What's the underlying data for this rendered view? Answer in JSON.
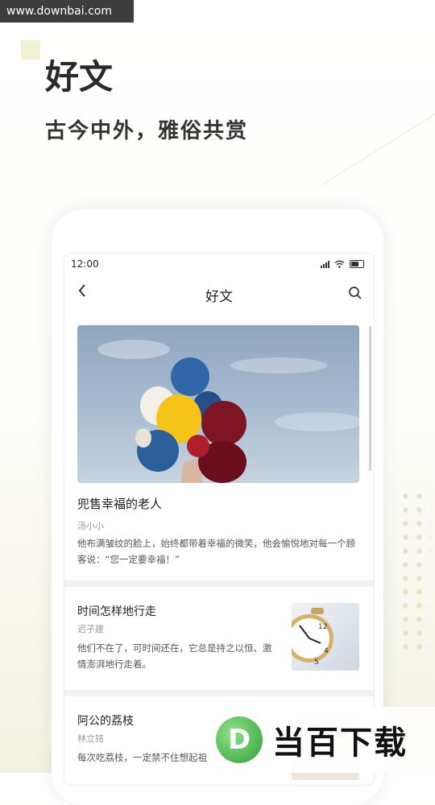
{
  "watermark_top": "www.downbai.com",
  "hero": {
    "title": "好文",
    "subtitle": "古今中外，雅俗共赏"
  },
  "statusbar": {
    "time": "12:00"
  },
  "nav": {
    "back_icon": "chevron-left-icon",
    "title": "好文",
    "search_icon": "search-icon"
  },
  "articles": [
    {
      "title": "兜售幸福的老人",
      "author": "汤小小",
      "excerpt": "他布满皱纹的脸上，始终都带着幸福的微笑，他会愉悦地对每一个顾客说：“您一定要幸福！”",
      "image": "balloons-photo"
    },
    {
      "title": "时间怎样地行走",
      "author": "迟子建",
      "excerpt": "他们不在了，可时间还在，它总是持之以恒、激情澎湃地行走着。",
      "image": "clock-photo"
    },
    {
      "title": "阿公的荔枝",
      "author": "林立铭",
      "excerpt": "每次吃荔枝，一定禁不住想起祖",
      "image": "lychee-photo"
    }
  ],
  "brand_watermark": {
    "logo_letter": "D",
    "text": "当百下载",
    "color": "#3aa63f"
  }
}
